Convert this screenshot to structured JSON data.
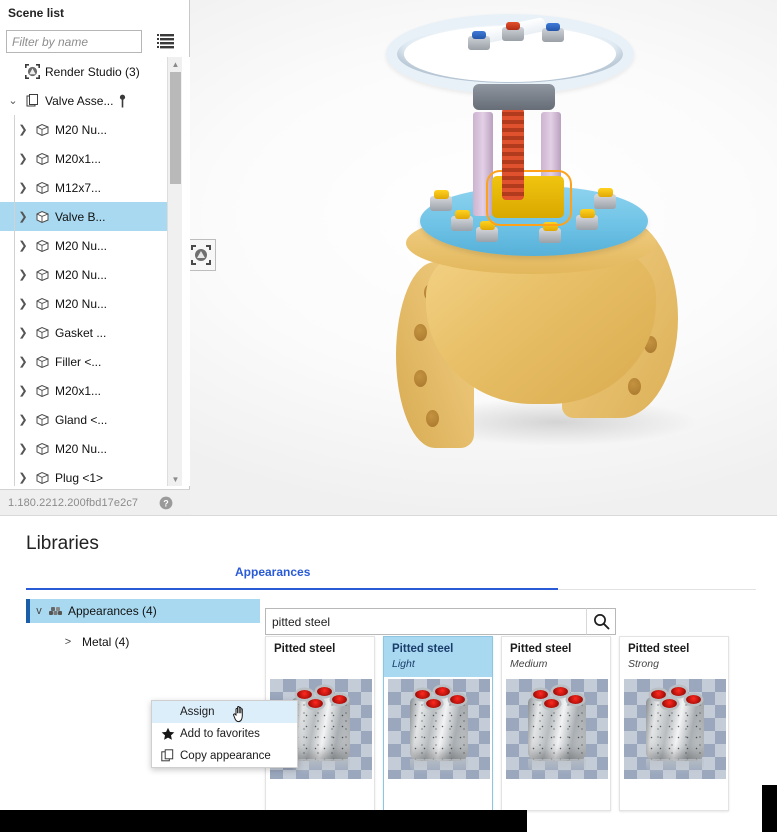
{
  "scene_panel": {
    "title": "Scene list",
    "filter_placeholder": "Filter by name",
    "filter_value": "",
    "list_options_icon": "list-options-icon",
    "version": "1.180.2212.200fbd17e2c7",
    "help_icon": "help-icon",
    "tree": [
      {
        "label": "Render Studio (3)",
        "icon": "render-studio-icon",
        "depth": 0,
        "twist": "",
        "selected": false
      },
      {
        "label": "Valve Asse...",
        "icon": "assembly-icon",
        "depth": 0,
        "twist": "v",
        "selected": false,
        "pin": true
      },
      {
        "label": "M20 Nu...",
        "icon": "part-icon",
        "depth": 1,
        "twist": ">",
        "selected": false
      },
      {
        "label": "M20x1...",
        "icon": "part-icon",
        "depth": 1,
        "twist": ">",
        "selected": false
      },
      {
        "label": "M12x7...",
        "icon": "part-icon",
        "depth": 1,
        "twist": ">",
        "selected": false
      },
      {
        "label": "Valve B...",
        "icon": "part-icon",
        "depth": 1,
        "twist": ">",
        "selected": true
      },
      {
        "label": "M20 Nu...",
        "icon": "part-icon",
        "depth": 1,
        "twist": ">",
        "selected": false
      },
      {
        "label": "M20 Nu...",
        "icon": "part-icon",
        "depth": 1,
        "twist": ">",
        "selected": false
      },
      {
        "label": "M20 Nu...",
        "icon": "part-icon",
        "depth": 1,
        "twist": ">",
        "selected": false
      },
      {
        "label": "Gasket ...",
        "icon": "part-icon",
        "depth": 1,
        "twist": ">",
        "selected": false
      },
      {
        "label": "Filler <...",
        "icon": "part-icon",
        "depth": 1,
        "twist": ">",
        "selected": false
      },
      {
        "label": "M20x1...",
        "icon": "part-icon",
        "depth": 1,
        "twist": ">",
        "selected": false
      },
      {
        "label": "Gland <...",
        "icon": "part-icon",
        "depth": 1,
        "twist": ">",
        "selected": false
      },
      {
        "label": "M20 Nu...",
        "icon": "part-icon",
        "depth": 1,
        "twist": ">",
        "selected": false
      },
      {
        "label": "Plug <1>",
        "icon": "part-icon",
        "depth": 1,
        "twist": ">",
        "selected": false
      }
    ]
  },
  "viewport": {
    "render_preview_icon": "render-preview-icon",
    "model": "Valve assembly 3D model"
  },
  "libraries": {
    "title": "Libraries",
    "tabs": [
      {
        "label": "Appearances",
        "active": true
      }
    ],
    "tree": {
      "root": {
        "label": "Appearances (4)",
        "twist": "v",
        "icon": "appearances-icon",
        "selected": true
      },
      "child": {
        "label": "Metal (4)",
        "twist": ">",
        "selected": false
      }
    },
    "search": {
      "value": "pitted steel",
      "placeholder": "Search",
      "clear_icon": "clear-icon",
      "search_icon": "search-icon"
    },
    "cards": [
      {
        "name": "Pitted steel",
        "variant": "",
        "selected": false
      },
      {
        "name": "Pitted steel",
        "variant": "Light",
        "selected": true
      },
      {
        "name": "Pitted steel",
        "variant": "Medium",
        "selected": false
      },
      {
        "name": "Pitted steel",
        "variant": "Strong",
        "selected": false
      }
    ],
    "context_menu": [
      {
        "label": "Assign",
        "icon": "",
        "highlighted": true
      },
      {
        "label": "Add to favorites",
        "icon": "star-icon",
        "highlighted": false
      },
      {
        "label": "Copy appearance",
        "icon": "copy-icon",
        "highlighted": false
      }
    ]
  },
  "colors": {
    "accent_blue": "#2a5bd7",
    "selection_blue": "#a8d9f0",
    "menu_highlight": "#ddeefb",
    "body_yellow": "#e8bf67",
    "bonnet_blue": "#6fc3e6"
  }
}
